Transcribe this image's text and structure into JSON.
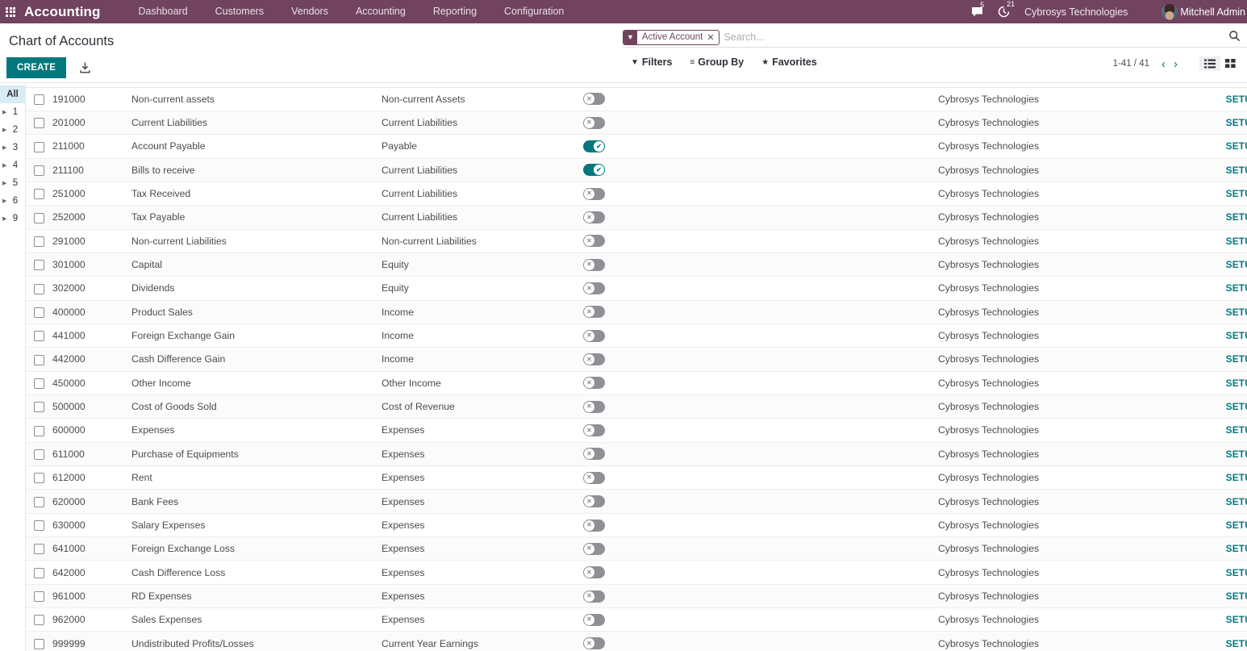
{
  "navbar": {
    "apps_icon": "apps-grid-icon",
    "brand": "Accounting",
    "menu": [
      {
        "label": "Dashboard"
      },
      {
        "label": "Customers"
      },
      {
        "label": "Vendors"
      },
      {
        "label": "Accounting"
      },
      {
        "label": "Reporting"
      },
      {
        "label": "Configuration"
      }
    ],
    "messages_icon": "chat-bubble-icon",
    "messages_count": "5",
    "activities_icon": "clock-activity-icon",
    "activities_count": "21",
    "company": "Cybrosys Technologies",
    "user": "Mitchell Admin",
    "avatar_icon": "user-avatar",
    "accent_color": "#71435f"
  },
  "control_panel": {
    "title": "Chart of Accounts",
    "create_label": "CREATE",
    "import_icon": "import-download-icon",
    "accent_color": "#00787d"
  },
  "search": {
    "facet_icon": "filter-funnel-icon",
    "facet_label": "Active Account",
    "facet_remove_icon": "close-x-icon",
    "placeholder": "Search...",
    "value": "",
    "magnifier_icon": "search-icon"
  },
  "filters": {
    "filters_label": "Filters",
    "filters_icon": "filter-funnel-icon",
    "groupby_label": "Group By",
    "groupby_icon": "hamburger-lines-icon",
    "favorites_label": "Favorites",
    "favorites_icon": "star-icon"
  },
  "pager": {
    "range": "1-41 / 41",
    "prev_icon": "chevron-left-icon",
    "next_icon": "chevron-right-icon",
    "list_view_icon": "list-view-icon",
    "kanban_view_icon": "kanban-view-icon",
    "active_view": "list"
  },
  "sidebar": {
    "items": [
      {
        "label": "All",
        "selected": true,
        "has_caret": false
      },
      {
        "label": "1",
        "selected": false,
        "has_caret": true
      },
      {
        "label": "2",
        "selected": false,
        "has_caret": true
      },
      {
        "label": "3",
        "selected": false,
        "has_caret": true
      },
      {
        "label": "4",
        "selected": false,
        "has_caret": true
      },
      {
        "label": "5",
        "selected": false,
        "has_caret": true
      },
      {
        "label": "6",
        "selected": false,
        "has_caret": true
      },
      {
        "label": "9",
        "selected": false,
        "has_caret": true
      }
    ]
  },
  "table": {
    "setup_label": "SETUP",
    "rows": [
      {
        "code": "191000",
        "name": "Non-current assets",
        "type": "Non-current Assets",
        "allow_reconciliation": false,
        "company": "Cybrosys Technologies"
      },
      {
        "code": "201000",
        "name": "Current Liabilities",
        "type": "Current Liabilities",
        "allow_reconciliation": false,
        "company": "Cybrosys Technologies"
      },
      {
        "code": "211000",
        "name": "Account Payable",
        "type": "Payable",
        "allow_reconciliation": true,
        "company": "Cybrosys Technologies"
      },
      {
        "code": "211100",
        "name": "Bills to receive",
        "type": "Current Liabilities",
        "allow_reconciliation": true,
        "company": "Cybrosys Technologies"
      },
      {
        "code": "251000",
        "name": "Tax Received",
        "type": "Current Liabilities",
        "allow_reconciliation": false,
        "company": "Cybrosys Technologies"
      },
      {
        "code": "252000",
        "name": "Tax Payable",
        "type": "Current Liabilities",
        "allow_reconciliation": false,
        "company": "Cybrosys Technologies"
      },
      {
        "code": "291000",
        "name": "Non-current Liabilities",
        "type": "Non-current Liabilities",
        "allow_reconciliation": false,
        "company": "Cybrosys Technologies"
      },
      {
        "code": "301000",
        "name": "Capital",
        "type": "Equity",
        "allow_reconciliation": false,
        "company": "Cybrosys Technologies"
      },
      {
        "code": "302000",
        "name": "Dividends",
        "type": "Equity",
        "allow_reconciliation": false,
        "company": "Cybrosys Technologies"
      },
      {
        "code": "400000",
        "name": "Product Sales",
        "type": "Income",
        "allow_reconciliation": false,
        "company": "Cybrosys Technologies"
      },
      {
        "code": "441000",
        "name": "Foreign Exchange Gain",
        "type": "Income",
        "allow_reconciliation": false,
        "company": "Cybrosys Technologies"
      },
      {
        "code": "442000",
        "name": "Cash Difference Gain",
        "type": "Income",
        "allow_reconciliation": false,
        "company": "Cybrosys Technologies"
      },
      {
        "code": "450000",
        "name": "Other Income",
        "type": "Other Income",
        "allow_reconciliation": false,
        "company": "Cybrosys Technologies"
      },
      {
        "code": "500000",
        "name": "Cost of Goods Sold",
        "type": "Cost of Revenue",
        "allow_reconciliation": false,
        "company": "Cybrosys Technologies"
      },
      {
        "code": "600000",
        "name": "Expenses",
        "type": "Expenses",
        "allow_reconciliation": false,
        "company": "Cybrosys Technologies"
      },
      {
        "code": "611000",
        "name": "Purchase of Equipments",
        "type": "Expenses",
        "allow_reconciliation": false,
        "company": "Cybrosys Technologies"
      },
      {
        "code": "612000",
        "name": "Rent",
        "type": "Expenses",
        "allow_reconciliation": false,
        "company": "Cybrosys Technologies"
      },
      {
        "code": "620000",
        "name": "Bank Fees",
        "type": "Expenses",
        "allow_reconciliation": false,
        "company": "Cybrosys Technologies"
      },
      {
        "code": "630000",
        "name": "Salary Expenses",
        "type": "Expenses",
        "allow_reconciliation": false,
        "company": "Cybrosys Technologies"
      },
      {
        "code": "641000",
        "name": "Foreign Exchange Loss",
        "type": "Expenses",
        "allow_reconciliation": false,
        "company": "Cybrosys Technologies"
      },
      {
        "code": "642000",
        "name": "Cash Difference Loss",
        "type": "Expenses",
        "allow_reconciliation": false,
        "company": "Cybrosys Technologies"
      },
      {
        "code": "961000",
        "name": "RD Expenses",
        "type": "Expenses",
        "allow_reconciliation": false,
        "company": "Cybrosys Technologies"
      },
      {
        "code": "962000",
        "name": "Sales Expenses",
        "type": "Expenses",
        "allow_reconciliation": false,
        "company": "Cybrosys Technologies"
      },
      {
        "code": "999999",
        "name": "Undistributed Profits/Losses",
        "type": "Current Year Earnings",
        "allow_reconciliation": false,
        "company": "Cybrosys Technologies"
      }
    ]
  }
}
